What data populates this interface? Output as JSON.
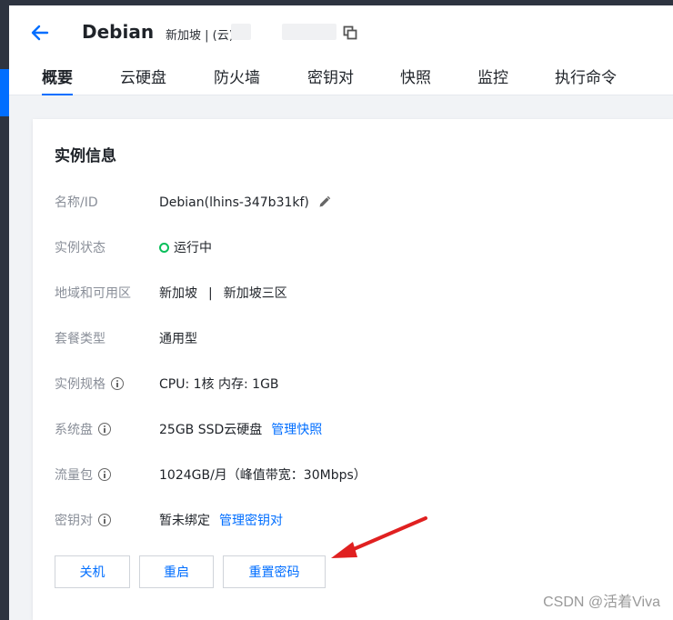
{
  "header": {
    "title": "Debian",
    "subtitle": "新加坡 | (云) ",
    "back_icon": "arrow-left-icon",
    "copy_icon": "copy-icon"
  },
  "tabs": [
    {
      "label": "概要",
      "active": true
    },
    {
      "label": "云硬盘",
      "active": false
    },
    {
      "label": "防火墙",
      "active": false
    },
    {
      "label": "密钥对",
      "active": false
    },
    {
      "label": "快照",
      "active": false
    },
    {
      "label": "监控",
      "active": false
    },
    {
      "label": "执行命令",
      "active": false
    }
  ],
  "card": {
    "title": "实例信息",
    "rows": {
      "name": {
        "label": "名称/ID",
        "value": "Debian(lhins-347b31kf)"
      },
      "status": {
        "label": "实例状态",
        "value": "运行中"
      },
      "region": {
        "label": "地域和可用区",
        "region": "新加坡",
        "separator": "|",
        "zone": "新加坡三区"
      },
      "package": {
        "label": "套餐类型",
        "value": "通用型"
      },
      "spec": {
        "label": "实例规格",
        "value": "CPU: 1核 内存: 1GB"
      },
      "disk": {
        "label": "系统盘",
        "value": "25GB SSD云硬盘",
        "link": "管理快照"
      },
      "traffic": {
        "label": "流量包",
        "value": "1024GB/月（峰值带宽：30Mbps）"
      },
      "keypair": {
        "label": "密钥对",
        "value": "暂未绑定",
        "link": "管理密钥对"
      }
    },
    "buttons": {
      "shutdown": "关机",
      "restart": "重启",
      "reset_password": "重置密码"
    }
  },
  "watermark": "CSDN @活着Viva",
  "colors": {
    "accent": "#006eff",
    "status_running": "#0abf5b",
    "annotation_arrow": "#e02020"
  }
}
